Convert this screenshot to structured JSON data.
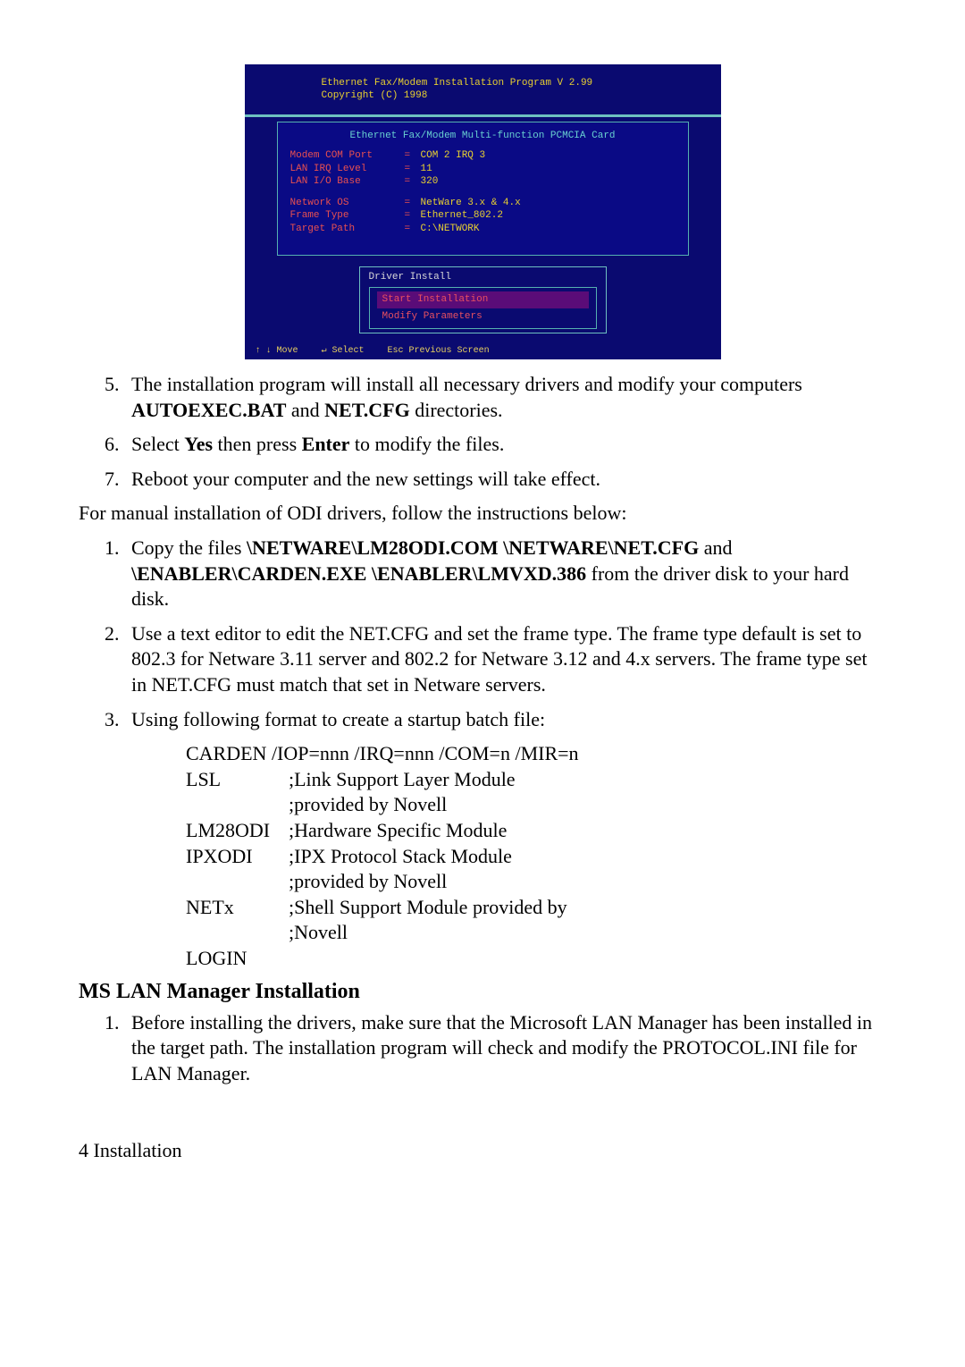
{
  "screenshot": {
    "title1": "Ethernet Fax/Modem Installation Program    V 2.99",
    "title2": "Copyright (C) 1998",
    "panelTitle": "Ethernet Fax/Modem Multi-function PCMCIA Card",
    "rows1": [
      {
        "label": "Modem COM Port",
        "value": "COM 2   IRQ 3"
      },
      {
        "label": "LAN IRQ Level",
        "value": "11"
      },
      {
        "label": "LAN I/O Base",
        "value": "320"
      }
    ],
    "rows2": [
      {
        "label": "Network OS",
        "value": "NetWare 3.x & 4.x"
      },
      {
        "label": "Frame Type",
        "value": "Ethernet_802.2"
      },
      {
        "label": "Target Path",
        "value": "C:\\NETWORK"
      }
    ],
    "box2Title": "Driver Install",
    "menu": [
      {
        "label": "Start Installation",
        "active": true
      },
      {
        "label": "Modify Parameters",
        "active": false
      }
    ],
    "footer": [
      "↑ ↓ Move",
      "↵ Select",
      "Esc Previous Screen"
    ]
  },
  "items_first": [
    {
      "n": "5",
      "html": "The installation program will install all necessary drivers and modify your computers <b>AUTOEXEC.BAT</b> and <b>NET.CFG</b> directories."
    },
    {
      "n": "6",
      "html": "Select <b>Yes</b> then press <b>Enter</b> to modify the files."
    },
    {
      "n": "7",
      "html": "Reboot your computer and the new settings will take effect."
    }
  ],
  "para1": "For manual installation of ODI drivers, follow the  instructions below:",
  "items_manual": [
    {
      "html": "Copy the files <b>\\NETWARE\\LM28ODI.COM \\NETWARE\\NET.CFG</b> and <b>\\ENABLER\\CARDEN.EXE  \\ENABLER\\LMVXD.386</b> from the driver disk to your hard disk."
    },
    {
      "html": "Use a text editor to edit the NET.CFG and set the frame type. The frame type default is set to 802.3 for Netware 3.11 server and 802.2 for Netware 3.12 and 4.x servers. The frame type set in NET.CFG must match that set in Netware servers."
    },
    {
      "html": "Using following format to create a startup batch file:"
    }
  ],
  "batch": {
    "line1": "CARDEN /IOP=nnn /IRQ=nnn /COM=n /MIR=n",
    "rows": [
      {
        "cmd": "LSL",
        "comment": ";Link Support Layer Module"
      },
      {
        "cmd": "",
        "comment": ";provided by Novell"
      },
      {
        "cmd": "LM28ODI",
        "comment": ";Hardware Specific Module"
      },
      {
        "cmd": "IPXODI",
        "comment": ";IPX Protocol Stack Module"
      },
      {
        "cmd": "",
        "comment": ";provided by Novell"
      },
      {
        "cmd": "NETx",
        "comment": ";Shell Support Module provided by"
      },
      {
        "cmd": "",
        "comment": ";Novell"
      },
      {
        "cmd": "LOGIN",
        "comment": ""
      }
    ]
  },
  "sectionTitle": "MS LAN Manager Installation",
  "items_ms": [
    {
      "html": "Before installing the drivers, make sure that the Microsoft LAN Manager has been installed in the target path. The installation program will check and modify the PROTOCOL.INI file for LAN Manager."
    }
  ],
  "footer": "4  Installation"
}
